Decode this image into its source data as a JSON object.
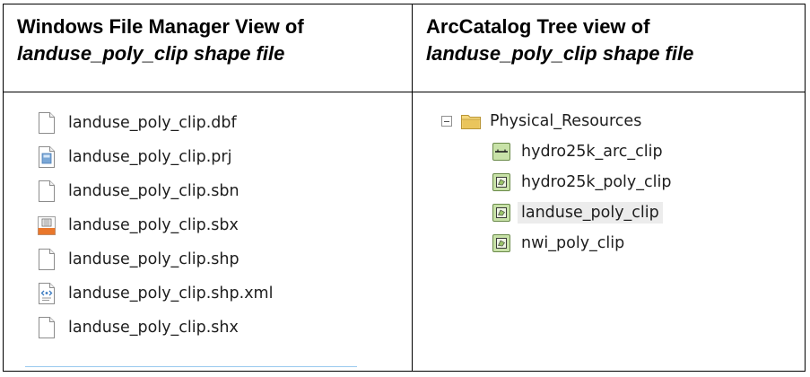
{
  "left_header": {
    "line1": "Windows File Manager View of",
    "line2": "landuse_poly_clip shape file"
  },
  "right_header": {
    "line1": "ArcCatalog Tree view of",
    "line2": "landuse_poly_clip shape file"
  },
  "files": [
    {
      "name": "landuse_poly_clip.dbf",
      "icon": "blank-file-icon"
    },
    {
      "name": "landuse_poly_clip.prj",
      "icon": "text-file-icon"
    },
    {
      "name": "landuse_poly_clip.sbn",
      "icon": "blank-file-icon"
    },
    {
      "name": "landuse_poly_clip.sbx",
      "icon": "sbx-file-icon"
    },
    {
      "name": "landuse_poly_clip.shp",
      "icon": "blank-file-icon"
    },
    {
      "name": "landuse_poly_clip.shp.xml",
      "icon": "xml-file-icon"
    },
    {
      "name": "landuse_poly_clip.shx",
      "icon": "blank-file-icon"
    }
  ],
  "tree": {
    "root_label": "Physical_Resources",
    "children": [
      {
        "label": "hydro25k_arc_clip",
        "icon": "line-feature-class-icon"
      },
      {
        "label": "hydro25k_poly_clip",
        "icon": "polygon-feature-class-icon"
      },
      {
        "label": "landuse_poly_clip",
        "icon": "polygon-feature-class-icon"
      },
      {
        "label": "nwi_poly_clip",
        "icon": "polygon-feature-class-icon"
      }
    ]
  },
  "colors": {
    "folder": "#e8c35a",
    "feature_class": "#b8d89a",
    "selection": "#ececec",
    "list_divider": "#99c9ef"
  }
}
